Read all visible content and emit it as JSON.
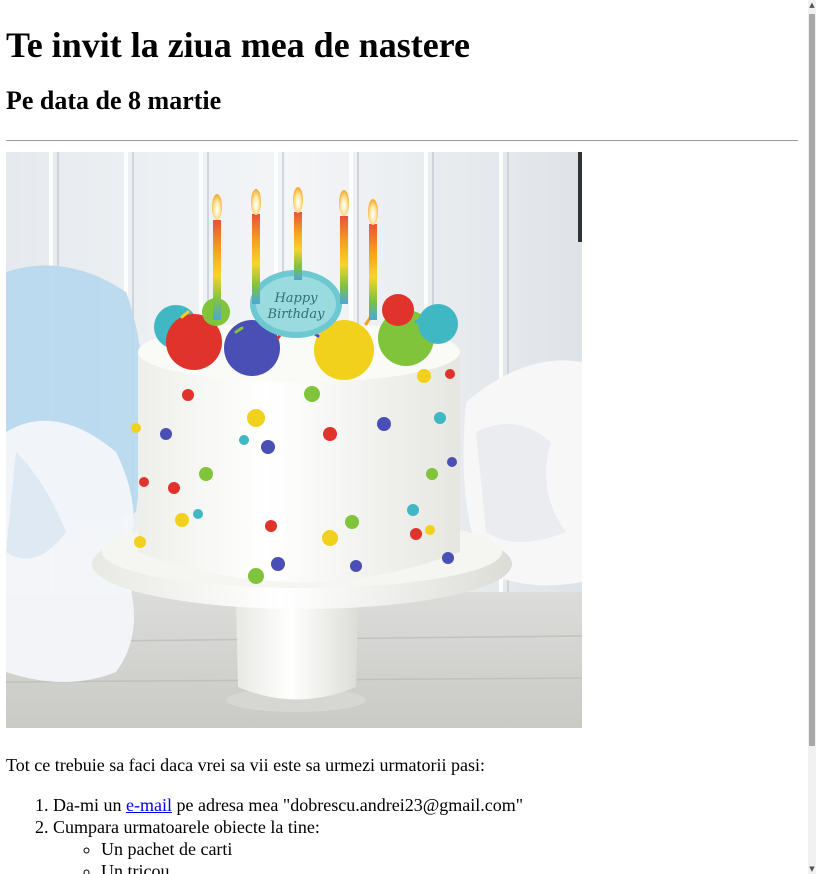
{
  "heading": "Te invit la ziua mea de nastere",
  "subheading": "Pe data de 8 martie",
  "image": {
    "alt": "Birthday cake",
    "topper_text": "Happy Birthday"
  },
  "intro": "Tot ce trebuie sa faci daca vrei sa vii este sa urmezi urmatorii pasi:",
  "steps": {
    "step1_before": "Da-mi un ",
    "step1_link": "e-mail",
    "step1_after": " pe adresa mea \"dobrescu.andrei23@gmail.com\"",
    "step2": "Cumpara urmatoarele obiecte la tine:",
    "items": [
      "Un pachet de carti",
      "Un tricou"
    ]
  },
  "scrollbar": {
    "up_arrow": "▲",
    "down_arrow": "▼"
  }
}
